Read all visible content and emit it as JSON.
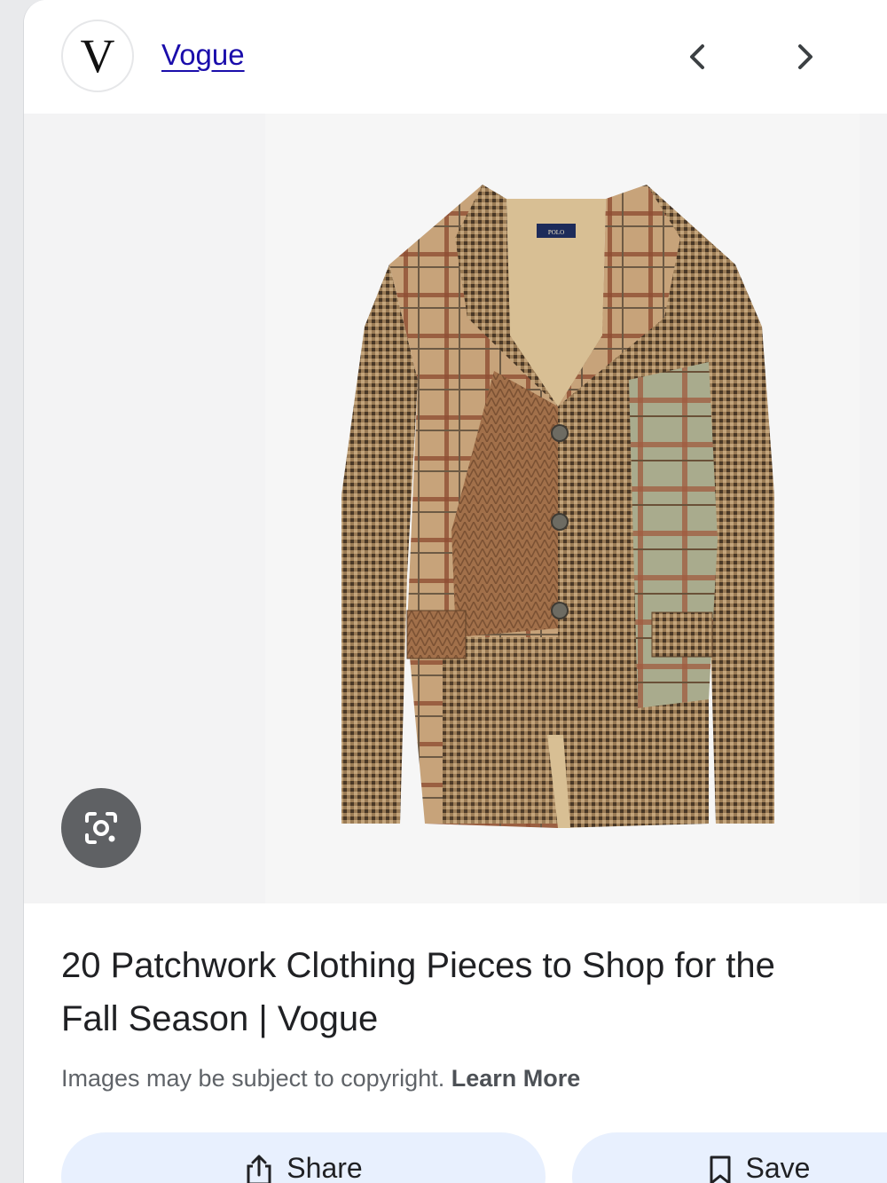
{
  "source": {
    "logo_letter": "V",
    "name": "Vogue"
  },
  "navigation": {
    "prev_icon": "chevron-left-icon",
    "next_icon": "chevron-right-icon"
  },
  "image": {
    "alt": "Patchwork plaid tweed blazer",
    "label_text": "POLO"
  },
  "lens": {
    "icon": "google-lens-icon"
  },
  "result": {
    "title": "20 Patchwork Clothing Pieces to Shop for the Fall Season | Vogue",
    "copyright_text": "Images may be subject to copyright.",
    "learn_more": "Learn More"
  },
  "actions": {
    "share_label": "Share",
    "save_label": "Save"
  },
  "colors": {
    "link": "#1a0dab",
    "button_bg": "#e8f0fe",
    "lens_bg": "#5f6164"
  }
}
